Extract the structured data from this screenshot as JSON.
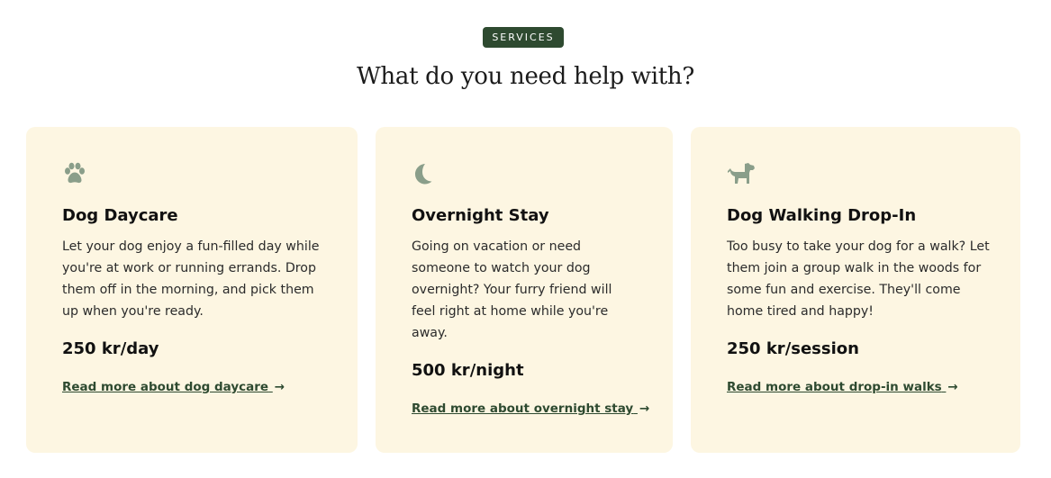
{
  "section": {
    "badge": "SERVICES",
    "heading": "What do you need help with?"
  },
  "colors": {
    "accent": "#2e4a30",
    "card_background": "#fdf6e2",
    "icon": "#8a9e8a"
  },
  "services": [
    {
      "icon": "paw-icon",
      "title": "Dog Daycare",
      "description": "Let your dog enjoy a fun-filled day while you're at work or running errands. Drop them off in the morning, and pick them up when you're ready.",
      "price": "250 kr/day",
      "link": "Read more about dog daycare",
      "arrow": "→"
    },
    {
      "icon": "moon-icon",
      "title": "Overnight Stay",
      "description": "Going on vacation or need someone to watch your dog overnight? Your furry friend will feel right at home while you're away.",
      "price": "500 kr/night",
      "link": "Read more about overnight stay",
      "arrow": "→"
    },
    {
      "icon": "dog-icon",
      "title": "Dog Walking Drop-In",
      "description": "Too busy to take your dog for a walk? Let them join a group walk in the woods for some fun and exercise. They'll come home tired and happy!",
      "price": "250 kr/session",
      "link": "Read more about drop-in walks",
      "arrow": "→"
    }
  ]
}
